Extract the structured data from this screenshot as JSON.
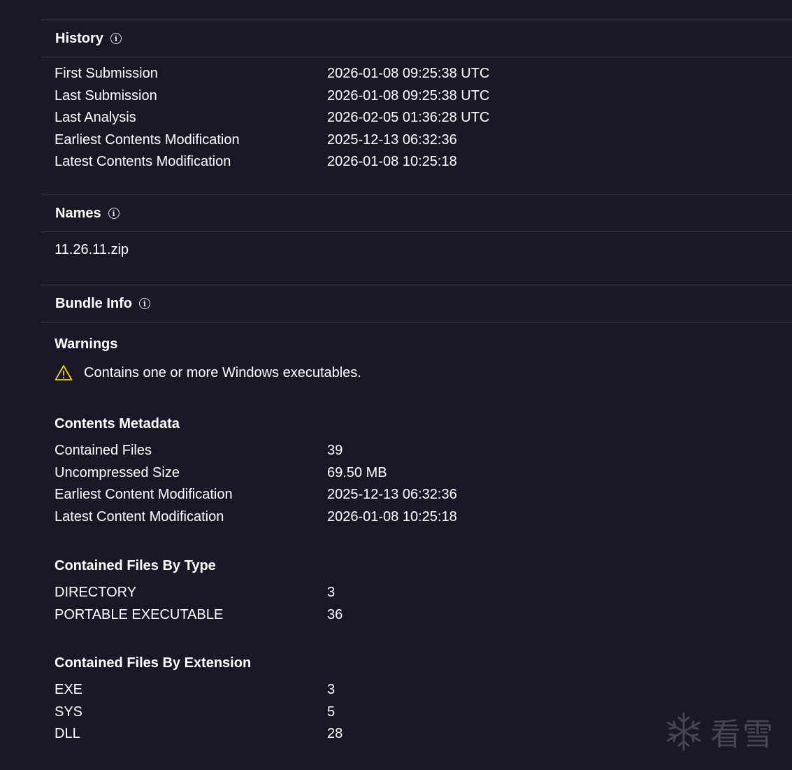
{
  "history": {
    "title": "History",
    "rows": [
      {
        "key": "First Submission",
        "value": "2026-01-08 09:25:38 UTC"
      },
      {
        "key": "Last Submission",
        "value": "2026-01-08 09:25:38 UTC"
      },
      {
        "key": "Last Analysis",
        "value": "2026-02-05 01:36:28 UTC"
      },
      {
        "key": "Earliest Contents Modification",
        "value": "2025-12-13 06:32:36"
      },
      {
        "key": "Latest Contents Modification",
        "value": "2026-01-08 10:25:18"
      }
    ]
  },
  "names": {
    "title": "Names",
    "items": [
      "11.26.11.zip"
    ]
  },
  "bundle_info": {
    "title": "Bundle Info",
    "warnings_title": "Warnings",
    "warnings": [
      "Contains one or more Windows executables."
    ],
    "contents_metadata": {
      "title": "Contents Metadata",
      "rows": [
        {
          "key": "Contained Files",
          "value": "39"
        },
        {
          "key": "Uncompressed Size",
          "value": "69.50 MB"
        },
        {
          "key": "Earliest Content Modification",
          "value": "2025-12-13 06:32:36"
        },
        {
          "key": "Latest Content Modification",
          "value": "2026-01-08 10:25:18"
        }
      ]
    },
    "by_type": {
      "title": "Contained Files By Type",
      "rows": [
        {
          "key": "DIRECTORY",
          "value": "3"
        },
        {
          "key": "PORTABLE EXECUTABLE",
          "value": "36"
        }
      ]
    },
    "by_extension": {
      "title": "Contained Files By Extension",
      "rows": [
        {
          "key": "EXE",
          "value": "3"
        },
        {
          "key": "SYS",
          "value": "5"
        },
        {
          "key": "DLL",
          "value": "28"
        }
      ]
    }
  },
  "watermark": {
    "text": "看雪",
    "icon": "snowflake-icon"
  },
  "colors": {
    "background": "#181826",
    "divider": "#3a3b4e",
    "warning": "#f2d200"
  }
}
